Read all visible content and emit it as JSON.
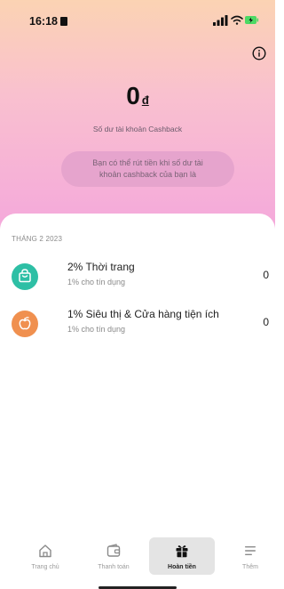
{
  "status_bar": {
    "time": "16:18"
  },
  "balance": {
    "amount": "0",
    "currency": "đ",
    "label": "Số dư tài khoản Cashback"
  },
  "note": {
    "line1": "Bạn có thể rút tiền khi số dư tài",
    "line2": "khoản cashback của bạn là"
  },
  "month_header": "THÁNG 2 2023",
  "categories": [
    {
      "title": "2% Thời trang",
      "subtitle": "1% cho tín dụng",
      "value": "0",
      "icon": "shopping-bag-icon",
      "color": "#2ebfa5"
    },
    {
      "title": "1% Siêu thị & Cửa hàng tiện ích",
      "subtitle": "1% cho tín dụng",
      "value": "0",
      "icon": "apple-icon",
      "color": "#f0904f"
    }
  ],
  "nav": {
    "items": [
      {
        "label": "Trang chủ",
        "icon": "home-icon"
      },
      {
        "label": "Thanh toán",
        "icon": "wallet-icon"
      },
      {
        "label": "Hoàn tiền",
        "icon": "gift-icon",
        "active": true
      },
      {
        "label": "Thêm",
        "icon": "menu-icon"
      }
    ]
  }
}
